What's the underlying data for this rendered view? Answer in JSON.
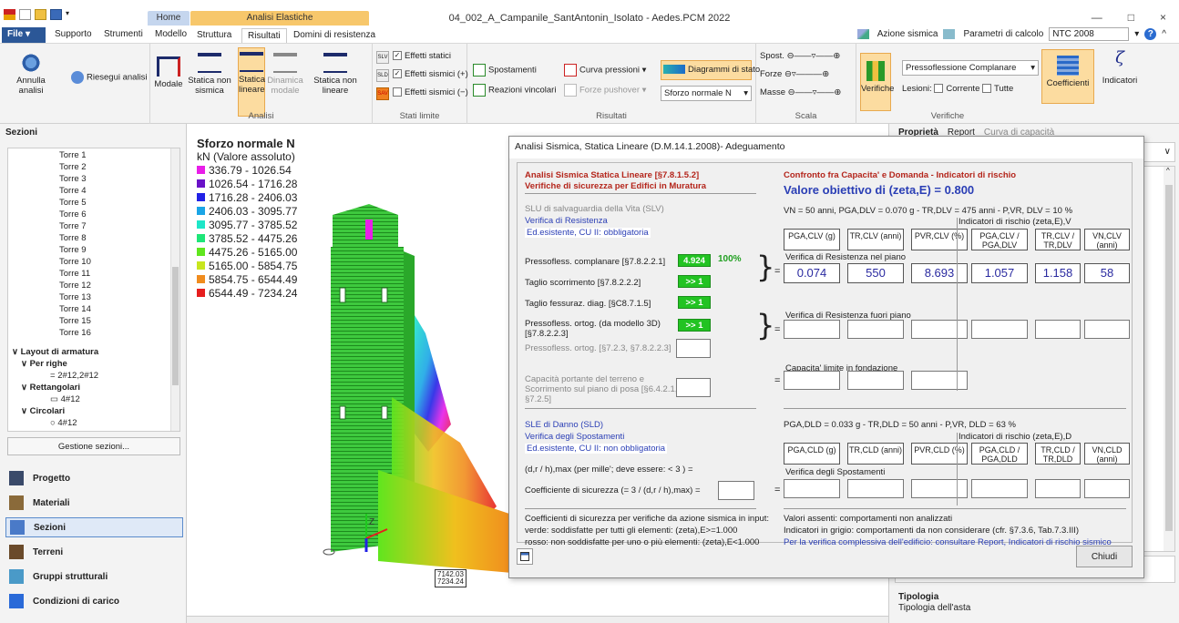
{
  "window": {
    "title": "04_002_A_Campanile_SantAntonin_Isolato - Aedes.PCM 2022",
    "minimize": "—",
    "maximize": "□",
    "close": "×"
  },
  "menu": {
    "file": "File ▾",
    "items": [
      "Supporto",
      "Strumenti",
      "Modello",
      "Struttura",
      "Risultati",
      "Domini di resistenza"
    ],
    "context_headers": {
      "home": "Home",
      "analisi": "Analisi Elastiche"
    },
    "right": {
      "azione": "Azione sismica",
      "parametri": "Parametri di calcolo",
      "norm": "NTC 2008",
      "help": "?"
    }
  },
  "ribbon": {
    "group_annulla": {
      "annulla": "Annulla analisi",
      "riesegui": "Riesegui analisi"
    },
    "group_analisi": {
      "label": "Analisi",
      "buttons": [
        {
          "name": "Modale",
          "icon": "modal-icon"
        },
        {
          "name": "Statica non sismica",
          "icon": "static-nonseismic-icon"
        },
        {
          "name": "Statica lineare",
          "icon": "static-linear-icon"
        },
        {
          "name": "Dinamica modale",
          "icon": "dynamic-modal-icon"
        },
        {
          "name": "Statica non lineare",
          "icon": "static-nonlinear-icon"
        }
      ]
    },
    "group_stati": {
      "label": "Stati limite",
      "slv": "SLV",
      "sld": "SLD",
      "sav": "SAV",
      "checks": [
        {
          "label": "Effetti statici",
          "checked": true
        },
        {
          "label": "Effetti sismici (+)",
          "checked": true
        },
        {
          "label": "Effetti sismici (−)",
          "checked": false
        }
      ]
    },
    "group_risultati": {
      "label": "Risultati",
      "spostamenti": "Spostamenti",
      "reazioni": "Reazioni vincolari",
      "curva": "Curva pressioni ▾",
      "forze": "Forze pushover ▾",
      "diagrammi": "Diagrammi di stato",
      "sforzo_combo": "Sforzo normale N"
    },
    "group_scala": {
      "label": "Scala",
      "rows": [
        "Spost.",
        "Forze",
        "Masse"
      ]
    },
    "group_verifiche": {
      "label": "Verifiche",
      "verifiche": "Verifiche",
      "combo": "Pressoflessione Complanare",
      "lesioni": "Lesioni:",
      "corrente": "Corrente",
      "tutte": "Tutte",
      "coefficienti": "Coefficienti",
      "indicatori": "Indicatori"
    }
  },
  "left_panel": {
    "title": "Sezioni",
    "towers": [
      "Torre 1",
      "Torre 2",
      "Torre 3",
      "Torre 4",
      "Torre 5",
      "Torre 6",
      "Torre 7",
      "Torre 8",
      "Torre 9",
      "Torre 10",
      "Torre 11",
      "Torre 12",
      "Torre 13",
      "Torre 14",
      "Torre 15",
      "Torre 16"
    ],
    "layout": "Layout di armatura",
    "per_righe": "Per righe",
    "per_righe_item": "2#12,2#12",
    "rettangolari": "Rettangolari",
    "rettangolari_item": "4#12",
    "circolari": "Circolari",
    "circolari_item": "4#12",
    "gestione": "Gestione sezioni...",
    "nav": [
      {
        "label": "Progetto",
        "icon": "project-icon"
      },
      {
        "label": "Materiali",
        "icon": "materials-icon"
      },
      {
        "label": "Sezioni",
        "icon": "sections-icon"
      },
      {
        "label": "Terreni",
        "icon": "soils-icon"
      },
      {
        "label": "Gruppi strutturali",
        "icon": "structural-groups-icon"
      },
      {
        "label": "Condizioni di carico",
        "icon": "load-conditions-icon"
      }
    ]
  },
  "legend": {
    "title": "Sforzo normale N",
    "subtitle": "kN (Valore assoluto)",
    "items": [
      {
        "label": "336.79 - 1026.54",
        "color": "#e81ee8"
      },
      {
        "label": "1026.54 - 1716.28",
        "color": "#6a12c8"
      },
      {
        "label": "1716.28 - 2406.03",
        "color": "#2222e6"
      },
      {
        "label": "2406.03 - 3095.77",
        "color": "#1aa5e6"
      },
      {
        "label": "3095.77 - 3785.52",
        "color": "#1ee6c8"
      },
      {
        "label": "3785.52 - 4475.26",
        "color": "#1ee678"
      },
      {
        "label": "4475.26 - 5165.00",
        "color": "#60e61e"
      },
      {
        "label": "5165.00 - 5854.75",
        "color": "#c8e61e"
      },
      {
        "label": "5854.75 - 6544.49",
        "color": "#f08c1e"
      },
      {
        "label": "6544.49 - 7234.24",
        "color": "#e61e1e"
      }
    ],
    "node_label_1": "7142.03",
    "node_label_2": "7234.24"
  },
  "right_panel": {
    "tabs": [
      "Proprietà",
      "Report",
      "Curva di capacità"
    ],
    "tipologia_title": "Tipologia",
    "tipologia_desc": "Tipologia dell'asta"
  },
  "dialog": {
    "title": "Analisi Sismica, Statica Lineare (D.M.14.1.2008)- Adeguamento",
    "left": {
      "h1": "Analisi Sismica Statica Lineare [§7.8.1.5.2]",
      "h2": "Verifiche di sicurezza per Edifici in Muratura",
      "slv": "SLU di salvaguardia della Vita (SLV)",
      "ver_res": "Verifica di Resistenza",
      "ed_esist": "Ed.esistente, CU II: obbligatoria",
      "rows": [
        {
          "label": "Pressofless. complanare [§7.8.2.2.1]",
          "value": "4.924",
          "pct": "100%"
        },
        {
          "label": "Taglio scorrimento [§7.8.2.2.2]",
          "value": ">> 1"
        },
        {
          "label": "Taglio fessuraz. diag. [§C8.7.1.5]",
          "value": ">> 1"
        },
        {
          "label": "Pressofless. ortog. (da modello 3D) [§7.8.2.2.3]",
          "value": ">> 1"
        }
      ],
      "ortog_gray": "Pressofless. ortog. [§7.2.3, §7.8.2.2.3]",
      "capacita": "Capacità portante del terreno e Scorrimento sul piano di posa [§6.4.2.1, §7.2.5]",
      "sld": "SLE di Danno (SLD)",
      "ver_spost": "Verifica degli Spostamenti",
      "ed_esist2": "Ed.esistente, CU II: non obbligatoria",
      "drh": "(d,r / h),max (per mille'; deve essere: < 3 ) =",
      "coeff": "Coefficiente di sicurezza (= 3 / (d,r / h),max) =",
      "foot1": "Coefficienti di sicurezza per verifiche da azione sismica in input:",
      "foot2": "verde: soddisfatte per tutti gli elementi: (zeta),E>=1.000",
      "foot3": "rosso: non soddisfatte per uno o più elementi: (zeta),E<1.000"
    },
    "right": {
      "h1": "Confronto fra Capacita' e Domanda - Indicatori di rischio",
      "obj": "Valore obiettivo di (zeta,E) = 0.800",
      "vn_slv": "VN = 50 anni, PGA,DLV = 0.070 g - TR,DLV = 475 anni - P,VR, DLV = 10 %",
      "ind_slv": "Indicatori di rischio (zeta,E),V",
      "hdr_slv": [
        "PGA,CLV (g)",
        "TR,CLV (anni)",
        "PVR,CLV (%)",
        "PGA,CLV / PGA,DLV",
        "TR,CLV / TR,DLV",
        "VN,CLV (anni)"
      ],
      "ver_piano": "Verifica di Resistenza nel piano",
      "vals_slv": [
        "0.074",
        "550",
        "8.693",
        "1.057",
        "1.158",
        "58"
      ],
      "ver_fuori": "Verifica di Resistenza fuori piano",
      "cap_fond": "Capacita' limite in fondazione",
      "pga_sld": "PGA,DLD = 0.033 g - TR,DLD = 50 anni - P,VR, DLD = 63 %",
      "ind_sld": "Indicatori di rischio (zeta,E),D",
      "hdr_sld": [
        "PGA,CLD (g)",
        "TR,CLD (anni)",
        "PVR,CLD (%)",
        "PGA,CLD / PGA,DLD",
        "TR,CLD / TR,DLD",
        "VN,CLD (anni)"
      ],
      "ver_spost": "Verifica degli Spostamenti",
      "foot1": "Valori assenti: comportamenti non analizzati",
      "foot2": "Indicatori in grigio: comportamenti da non considerare (cfr. §7.3.6, Tab.7.3.III)",
      "foot3": "Per la verifica complessiva dell'edificio: consultare Report, Indicatori di rischio sismico",
      "eq": "="
    },
    "close": "Chiudi"
  }
}
